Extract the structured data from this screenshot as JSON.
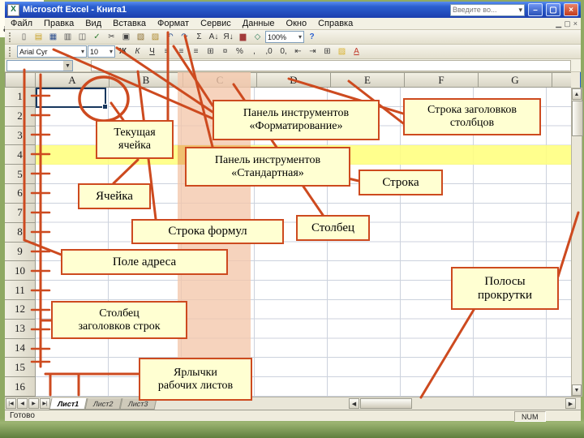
{
  "window": {
    "title": "Microsoft Excel - Книга1",
    "icon_letter": "X",
    "question_box": "Введите во...",
    "buttons": {
      "minimize": "–",
      "restore": "▢",
      "close": "×"
    }
  },
  "menu": {
    "items": [
      "Файл",
      "Правка",
      "Вид",
      "Вставка",
      "Формат",
      "Сервис",
      "Данные",
      "Окно",
      "Справка"
    ],
    "window_controls": [
      "▁",
      "▢",
      "×"
    ]
  },
  "standard_toolbar": {
    "zoom": "100%",
    "help_glyph": "?",
    "icons": [
      {
        "name": "new-icon",
        "glyph": "▯",
        "color": "#555555"
      },
      {
        "name": "open-icon",
        "glyph": "▤",
        "color": "#c9a227"
      },
      {
        "name": "save-icon",
        "glyph": "▦",
        "color": "#2e4f8f"
      },
      {
        "name": "print-icon",
        "glyph": "▥",
        "color": "#555555"
      },
      {
        "name": "print-preview-icon",
        "glyph": "◫",
        "color": "#555555"
      },
      {
        "name": "spelling-icon",
        "glyph": "✓",
        "color": "#2e7d32"
      },
      {
        "name": "cut-icon",
        "glyph": "✂",
        "color": "#444444"
      },
      {
        "name": "copy-icon",
        "glyph": "▣",
        "color": "#444444"
      },
      {
        "name": "paste-icon",
        "glyph": "▧",
        "color": "#8a6d2f"
      },
      {
        "name": "format-painter-icon",
        "glyph": "▨",
        "color": "#b08a2e"
      },
      {
        "name": "undo-icon",
        "glyph": "↶",
        "color": "#2e4f8f"
      },
      {
        "name": "redo-icon",
        "glyph": "↷",
        "color": "#2e4f8f"
      },
      {
        "name": "autosum-icon",
        "glyph": "Σ",
        "color": "#333333"
      },
      {
        "name": "sort-ascending-icon",
        "glyph": "A↓",
        "color": "#333333"
      },
      {
        "name": "sort-descending-icon",
        "glyph": "Я↓",
        "color": "#333333"
      },
      {
        "name": "chart-wizard-icon",
        "glyph": "▆",
        "color": "#a23b3b"
      },
      {
        "name": "drawing-icon",
        "glyph": "◇",
        "color": "#2e7d5b"
      }
    ]
  },
  "formatting_toolbar": {
    "font_name": "Arial Cyr",
    "font_size": "10",
    "icons": [
      {
        "name": "bold-icon",
        "glyph": "Ж",
        "cls": "b"
      },
      {
        "name": "italic-icon",
        "glyph": "К",
        "cls": "i"
      },
      {
        "name": "underline-icon",
        "glyph": "Ч",
        "cls": "u"
      },
      {
        "name": "align-left-icon",
        "glyph": "≡",
        "color": "#444444"
      },
      {
        "name": "align-center-icon",
        "glyph": "≡",
        "color": "#444444"
      },
      {
        "name": "align-right-icon",
        "glyph": "≡",
        "color": "#444444"
      },
      {
        "name": "merge-center-icon",
        "glyph": "⊞",
        "color": "#444444"
      },
      {
        "name": "currency-icon",
        "glyph": "¤",
        "color": "#333333"
      },
      {
        "name": "percent-icon",
        "glyph": "%",
        "color": "#333333"
      },
      {
        "name": "comma-icon",
        "glyph": ",",
        "color": "#333333"
      },
      {
        "name": "increase-decimal-icon",
        "glyph": ",0",
        "color": "#333333"
      },
      {
        "name": "decrease-decimal-icon",
        "glyph": "0,",
        "color": "#333333"
      },
      {
        "name": "decrease-indent-icon",
        "glyph": "⇤",
        "color": "#444444"
      },
      {
        "name": "increase-indent-icon",
        "glyph": "⇥",
        "color": "#444444"
      },
      {
        "name": "borders-icon",
        "glyph": "⊞",
        "color": "#444444"
      },
      {
        "name": "fill-color-icon",
        "glyph": "▨",
        "color": "#d9b12e"
      },
      {
        "name": "font-color-icon",
        "glyph": "А",
        "cls": "u",
        "color": "#c0392b"
      }
    ]
  },
  "grid": {
    "columns": [
      "A",
      "B",
      "C",
      "D",
      "E",
      "F",
      "G"
    ],
    "rows": [
      "1",
      "2",
      "3",
      "4",
      "5",
      "6",
      "7",
      "8",
      "9",
      "10",
      "11",
      "12",
      "13",
      "14",
      "15",
      "16"
    ]
  },
  "tab_nav": [
    "|◀",
    "◀",
    "▶",
    "▶|"
  ],
  "sheet_tabs": [
    "Лист1",
    "Лист2",
    "Лист3"
  ],
  "status": {
    "ready": "Готово",
    "num": "NUM"
  },
  "callouts": {
    "current_cell": "Текущая\nячейка",
    "partial": "авто",
    "formatting_toolbar": "Панель инструментов\n«Форматирование»",
    "column_headers_row": "Строка заголовков\nстолбцов",
    "standard_toolbar": "Панель инструментов\n«Стандартная»",
    "row": "Строка",
    "cell": "Ячейка",
    "formula_bar": "Строка формул",
    "column": "Столбец",
    "address_field": "Поле адреса",
    "scrollbars": "Полосы\nпрокрутки",
    "row_headers_column": "Столбец\nзаголовков строк",
    "worksheet_tabs": "Ярлычки\nрабочих листов"
  },
  "colors": {
    "annotation": "#cd4a1f",
    "callout_bg": "#ffffd2",
    "row_highlight": "#ffff7d",
    "column_highlight": "#f4c6aa",
    "titlebar": "#2b5fd0",
    "slide_green": "#8fa963"
  }
}
